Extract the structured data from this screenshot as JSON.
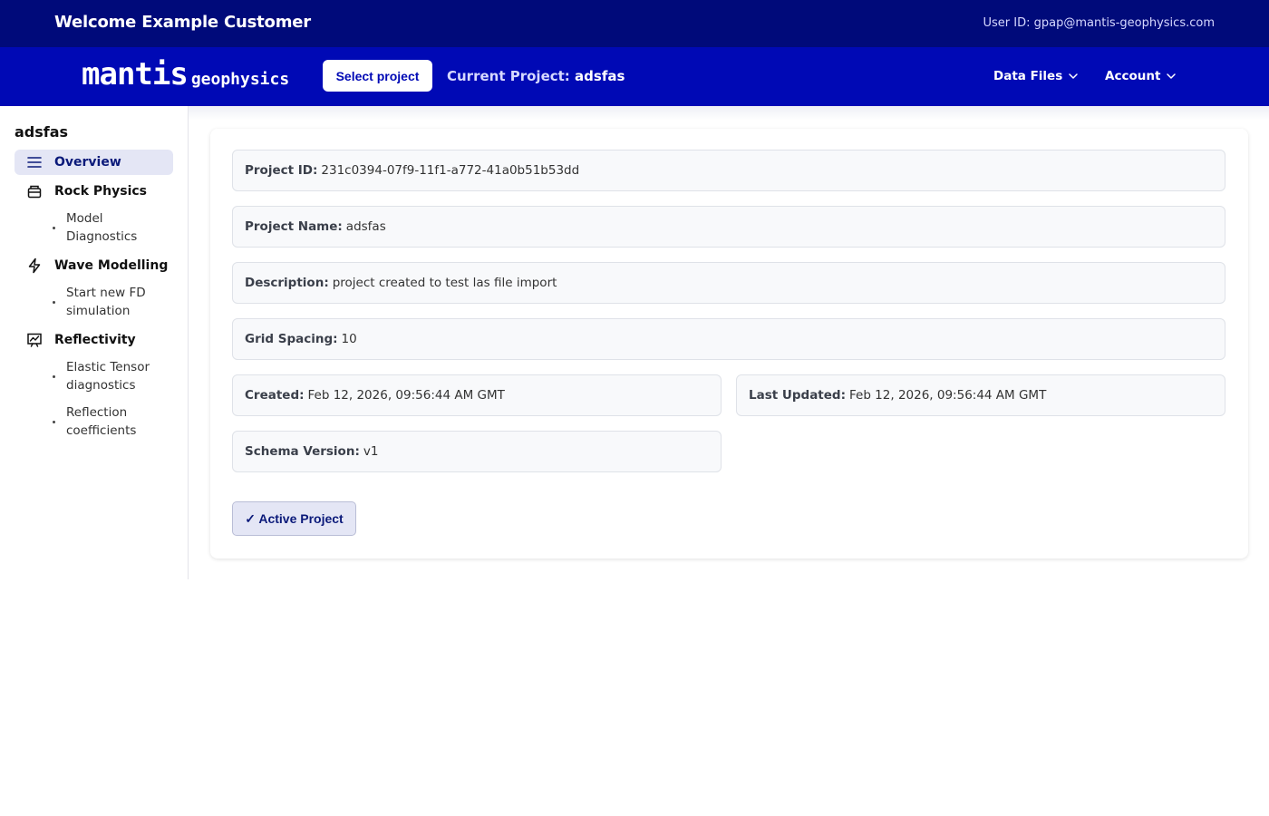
{
  "topbar": {
    "welcome": "Welcome Example Customer",
    "user_id": "User ID: gpap@mantis-geophysics.com"
  },
  "navbar": {
    "logo_main": "mantis",
    "logo_sub": "geophysics",
    "select_project_label": "Select project",
    "current_project_label": "Current Project:",
    "current_project_name": "adsfas",
    "menus": [
      {
        "label": "Data Files",
        "icon": "chevron-down-icon"
      },
      {
        "label": "Account",
        "icon": "chevron-down-icon"
      }
    ]
  },
  "sidebar": {
    "project_title": "adsfas",
    "items": [
      {
        "label": "Overview",
        "icon": "list-icon",
        "active": true
      },
      {
        "label": "Rock Physics",
        "icon": "database-icon",
        "subitems": [
          "Model Diagnostics"
        ]
      },
      {
        "label": "Wave Modelling",
        "icon": "lightning-icon",
        "subitems": [
          "Start new FD simulation"
        ]
      },
      {
        "label": "Reflectivity",
        "icon": "presentation-chart-icon",
        "subitems": [
          "Elastic Tensor diagnostics",
          "Reflection coefficients"
        ]
      }
    ]
  },
  "project": {
    "id_label": "Project ID:",
    "id_value": "231c0394-07f9-11f1-a772-41a0b51b53dd",
    "name_label": "Project Name:",
    "name_value": "adsfas",
    "description_label": "Description:",
    "description_value": "project created to test las file import",
    "grid_label": "Grid Spacing:",
    "grid_value": "10",
    "created_label": "Created:",
    "created_value": "Feb 12, 2026, 09:56:44 AM GMT",
    "updated_label": "Last Updated:",
    "updated_value": "Feb 12, 2026, 09:56:44 AM GMT",
    "schema_label": "Schema Version:",
    "schema_value": "v1",
    "active_button_label": "✓ Active Project"
  },
  "colors": {
    "topbar": "#000a7a",
    "navbar": "#0009b5",
    "active_bg": "#e4e6f5"
  }
}
